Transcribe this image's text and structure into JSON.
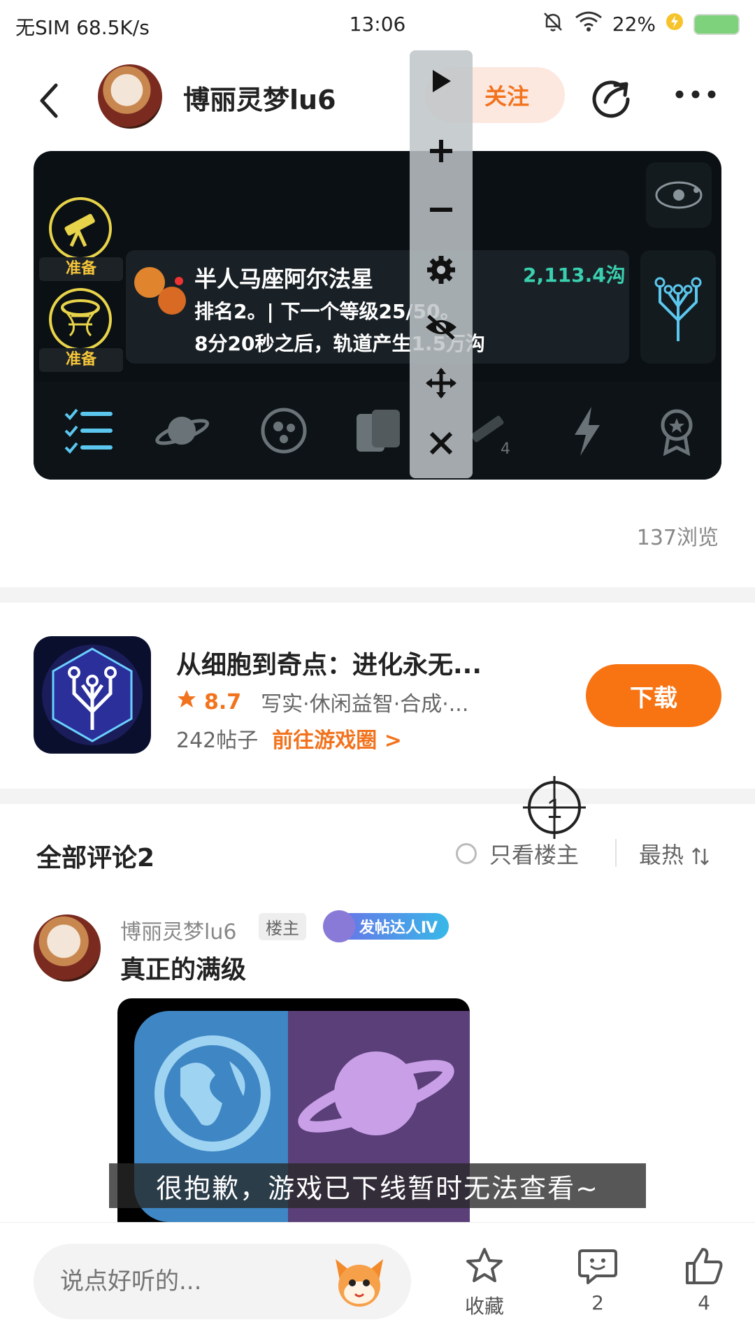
{
  "status_bar": {
    "left": "无SIM 68.5K/s",
    "time": "13:06",
    "battery": "22%"
  },
  "header": {
    "author": "博丽灵梦lu6",
    "follow_label": "关注"
  },
  "game_screenshot": {
    "ready_1": "准备",
    "ready_2": "准备",
    "star_name": "半人马座阿尔法星",
    "rank_line": "排名2。| 下一个等级25/50。",
    "orbit_line": "8分20秒之后，轨道产生1.5万沟",
    "currency": "2,113.4沟",
    "tab_badge": "4"
  },
  "views": "137浏览",
  "game_card": {
    "name": "从细胞到奇点：进化永无...",
    "rating": "8.7",
    "tags": "写实·休闲益智·合成·...",
    "posts": "242帖子",
    "goto": "前往游戏圈 >",
    "download": "下载"
  },
  "comments": {
    "title": "全部评论2",
    "only_host": "只看楼主",
    "sort": "最热"
  },
  "comment": {
    "author": "博丽灵梦lu6",
    "host_badge": "楼主",
    "post_badge": "发帖达人Ⅳ",
    "text": "真正的满级"
  },
  "toast": "很抱歉，游戏已下线暂时无法查看~",
  "bottom_bar": {
    "placeholder": "说点好听的...",
    "favorite_label": "收藏",
    "comment_count": "2",
    "like_count": "4"
  },
  "colors": {
    "accent": "#f87312",
    "panel_bg": "#0b1014",
    "currency": "#39d0b0",
    "gold": "#e8d44a"
  }
}
